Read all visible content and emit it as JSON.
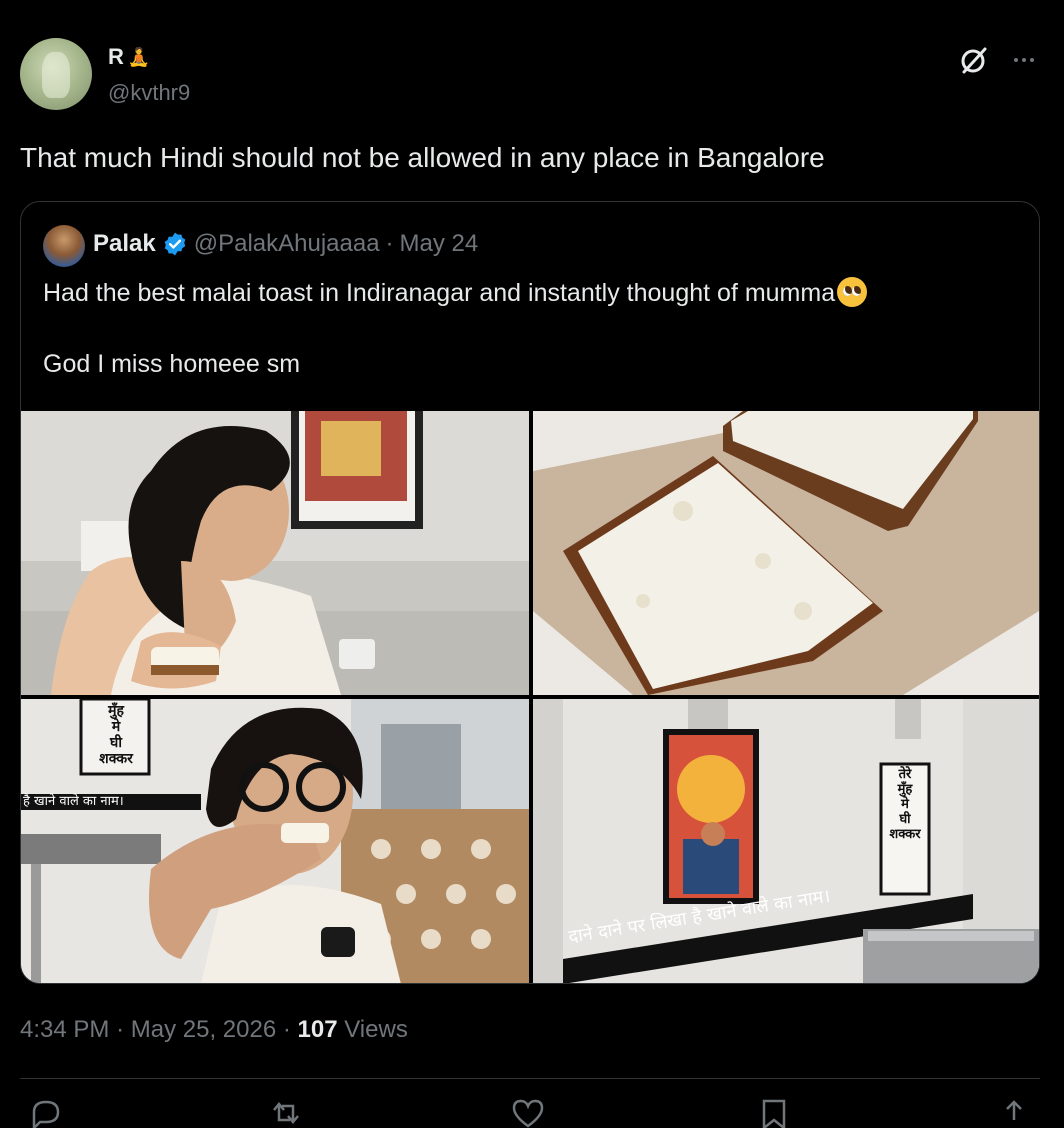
{
  "author": {
    "name": "R",
    "name_emoji": "meditation-emoji",
    "handle": "@kvthr9"
  },
  "tweet": {
    "text": "That much Hindi should not be allowed in any place in Bangalore",
    "time": "4:34 PM",
    "sep1": "·",
    "date": "May 25, 2026",
    "sep2": "·",
    "views_count": "107",
    "views_label": "Views"
  },
  "quoted": {
    "name": "Palak",
    "handle": "@PalakAhujaaaa",
    "sep": "·",
    "date": "May 24",
    "line1": "Had the best malai toast in Indiranagar and instantly thought of mumma",
    "line2": "God I miss homeee sm",
    "photo3_sign_top": [
      "मुँह",
      "मे",
      "घी",
      "शक्कर"
    ],
    "photo3_sign_band": "है खाने वाले का नाम।",
    "photo4_sign_top": [
      "तेरे",
      "मुँह",
      "मे",
      "घी",
      "शक्कर"
    ],
    "photo4_sign_band": "दाने दाने पर लिखा है खाने वाले का नाम।"
  },
  "colors": {
    "background": "#000000",
    "text_primary": "#e7e9ea",
    "text_secondary": "#71767b",
    "border": "#2f3336",
    "verified": "#1d9bf0"
  },
  "icons": [
    "grok-icon",
    "more-icon",
    "verified-badge-icon",
    "reply-icon",
    "retweet-icon",
    "like-icon",
    "bookmark-icon",
    "share-icon"
  ]
}
